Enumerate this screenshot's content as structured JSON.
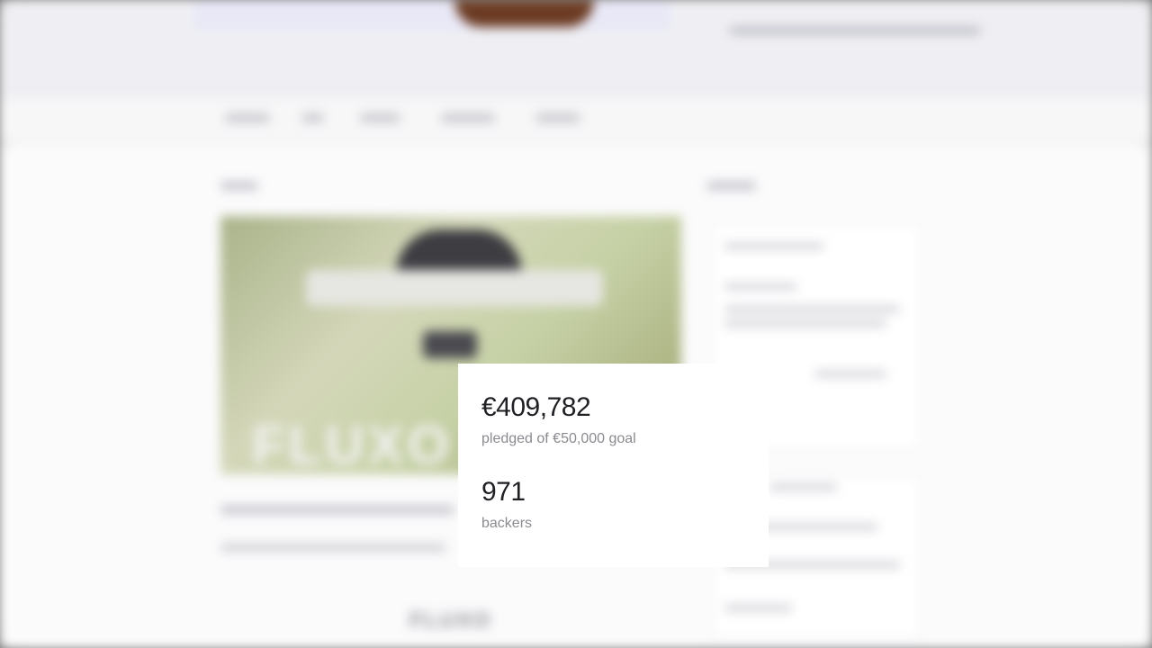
{
  "background": {
    "hero_title": "FLUXO",
    "bottom_title": "FLUXO"
  },
  "stats": {
    "pledged_amount": "€409,782",
    "pledged_label": "pledged of €50,000 goal",
    "backers_count": "971",
    "backers_label": "backers"
  }
}
